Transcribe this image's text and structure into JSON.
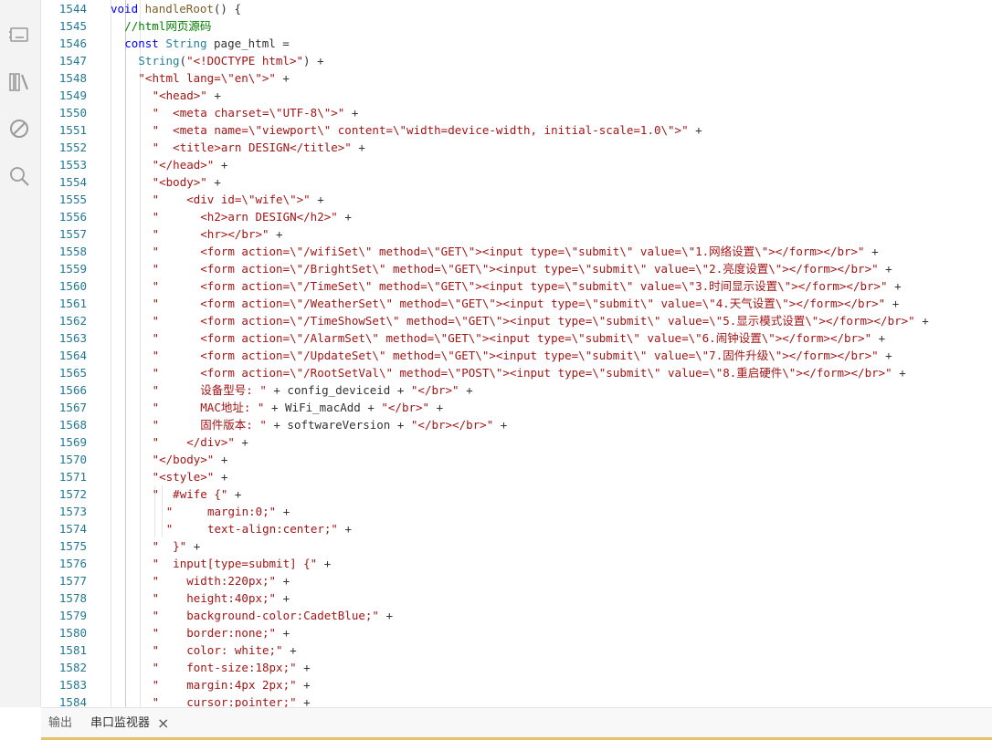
{
  "activity_bar": {
    "icons": [
      "board-icon",
      "library-icon",
      "debug-icon",
      "search-icon"
    ]
  },
  "editor": {
    "lines": [
      {
        "n": "1544",
        "indent": 0,
        "segs": [
          [
            "kw",
            "void "
          ],
          [
            "fn",
            "handleRoot"
          ],
          [
            "pl",
            "() {"
          ]
        ]
      },
      {
        "n": "1545",
        "indent": 2,
        "segs": [
          [
            "cm",
            "//html网页源码"
          ]
        ]
      },
      {
        "n": "1546",
        "indent": 2,
        "segs": [
          [
            "kw",
            "const "
          ],
          [
            "ty",
            "String "
          ],
          [
            "pl",
            "page_html ="
          ]
        ]
      },
      {
        "n": "1547",
        "indent": 4,
        "segs": [
          [
            "ty",
            "String"
          ],
          [
            "pl",
            "("
          ],
          [
            "str",
            "\"<!DOCTYPE html>\""
          ],
          [
            "pl",
            ") +"
          ]
        ]
      },
      {
        "n": "1548",
        "indent": 4,
        "segs": [
          [
            "str",
            "\"<html lang=\\\"en\\\">\""
          ],
          [
            "pl",
            " +"
          ]
        ]
      },
      {
        "n": "1549",
        "indent": 6,
        "segs": [
          [
            "str",
            "\"<head>\""
          ],
          [
            "pl",
            " +"
          ]
        ]
      },
      {
        "n": "1550",
        "indent": 6,
        "segs": [
          [
            "str",
            "\"  <meta charset=\\\"UTF-8\\\">\""
          ],
          [
            "pl",
            " +"
          ]
        ]
      },
      {
        "n": "1551",
        "indent": 6,
        "segs": [
          [
            "str",
            "\"  <meta name=\\\"viewport\\\" content=\\\"width=device-width, initial-scale=1.0\\\">\""
          ],
          [
            "pl",
            " +"
          ]
        ]
      },
      {
        "n": "1552",
        "indent": 6,
        "segs": [
          [
            "str",
            "\"  <title>arn DESIGN</title>\""
          ],
          [
            "pl",
            " +"
          ]
        ]
      },
      {
        "n": "1553",
        "indent": 6,
        "segs": [
          [
            "str",
            "\"</head>\""
          ],
          [
            "pl",
            " +"
          ]
        ]
      },
      {
        "n": "1554",
        "indent": 6,
        "segs": [
          [
            "str",
            "\"<body>\""
          ],
          [
            "pl",
            " +"
          ]
        ]
      },
      {
        "n": "1555",
        "indent": 6,
        "segs": [
          [
            "str",
            "\"    <div id=\\\"wife\\\">\""
          ],
          [
            "pl",
            " +"
          ]
        ]
      },
      {
        "n": "1556",
        "indent": 6,
        "segs": [
          [
            "str",
            "\"      <h2>arn DESIGN</h2>\""
          ],
          [
            "pl",
            " +"
          ]
        ]
      },
      {
        "n": "1557",
        "indent": 6,
        "segs": [
          [
            "str",
            "\"      <hr></br>\""
          ],
          [
            "pl",
            " +"
          ]
        ]
      },
      {
        "n": "1558",
        "indent": 6,
        "segs": [
          [
            "str",
            "\"      <form action=\\\"/wifiSet\\\" method=\\\"GET\\\"><input type=\\\"submit\\\" value=\\\"1.网络设置\\\"></form></br>\""
          ],
          [
            "pl",
            " +"
          ]
        ]
      },
      {
        "n": "1559",
        "indent": 6,
        "segs": [
          [
            "str",
            "\"      <form action=\\\"/BrightSet\\\" method=\\\"GET\\\"><input type=\\\"submit\\\" value=\\\"2.亮度设置\\\"></form></br>\""
          ],
          [
            "pl",
            " +"
          ]
        ]
      },
      {
        "n": "1560",
        "indent": 6,
        "segs": [
          [
            "str",
            "\"      <form action=\\\"/TimeSet\\\" method=\\\"GET\\\"><input type=\\\"submit\\\" value=\\\"3.时间显示设置\\\"></form></br>\""
          ],
          [
            "pl",
            " +"
          ]
        ]
      },
      {
        "n": "1561",
        "indent": 6,
        "segs": [
          [
            "str",
            "\"      <form action=\\\"/WeatherSet\\\" method=\\\"GET\\\"><input type=\\\"submit\\\" value=\\\"4.天气设置\\\"></form></br>\""
          ],
          [
            "pl",
            " +"
          ]
        ]
      },
      {
        "n": "1562",
        "indent": 6,
        "segs": [
          [
            "str",
            "\"      <form action=\\\"/TimeShowSet\\\" method=\\\"GET\\\"><input type=\\\"submit\\\" value=\\\"5.显示模式设置\\\"></form></br>\""
          ],
          [
            "pl",
            " +"
          ]
        ]
      },
      {
        "n": "1563",
        "indent": 6,
        "segs": [
          [
            "str",
            "\"      <form action=\\\"/AlarmSet\\\" method=\\\"GET\\\"><input type=\\\"submit\\\" value=\\\"6.闹钟设置\\\"></form></br>\""
          ],
          [
            "pl",
            " +"
          ]
        ]
      },
      {
        "n": "1564",
        "indent": 6,
        "segs": [
          [
            "str",
            "\"      <form action=\\\"/UpdateSet\\\" method=\\\"GET\\\"><input type=\\\"submit\\\" value=\\\"7.固件升级\\\"></form></br>\""
          ],
          [
            "pl",
            " +"
          ]
        ]
      },
      {
        "n": "1565",
        "indent": 6,
        "segs": [
          [
            "str",
            "\"      <form action=\\\"/RootSetVal\\\" method=\\\"POST\\\"><input type=\\\"submit\\\" value=\\\"8.重启硬件\\\"></form></br>\""
          ],
          [
            "pl",
            " +"
          ]
        ]
      },
      {
        "n": "1566",
        "indent": 6,
        "segs": [
          [
            "str",
            "\"      设备型号: \""
          ],
          [
            "pl",
            " + config_deviceid + "
          ],
          [
            "str",
            "\"</br>\""
          ],
          [
            "pl",
            " +"
          ]
        ]
      },
      {
        "n": "1567",
        "indent": 6,
        "segs": [
          [
            "str",
            "\"      MAC地址: \""
          ],
          [
            "pl",
            " + WiFi_macAdd + "
          ],
          [
            "str",
            "\"</br>\""
          ],
          [
            "pl",
            " +"
          ]
        ]
      },
      {
        "n": "1568",
        "indent": 6,
        "segs": [
          [
            "str",
            "\"      固件版本: \""
          ],
          [
            "pl",
            " + softwareVersion + "
          ],
          [
            "str",
            "\"</br></br>\""
          ],
          [
            "pl",
            " +"
          ]
        ]
      },
      {
        "n": "1569",
        "indent": 6,
        "segs": [
          [
            "str",
            "\"    </div>\""
          ],
          [
            "pl",
            " +"
          ]
        ]
      },
      {
        "n": "1570",
        "indent": 6,
        "segs": [
          [
            "str",
            "\"</body>\""
          ],
          [
            "pl",
            " +"
          ]
        ]
      },
      {
        "n": "1571",
        "indent": 6,
        "segs": [
          [
            "str",
            "\"<style>\""
          ],
          [
            "pl",
            " +"
          ]
        ]
      },
      {
        "n": "1572",
        "indent": 6,
        "segs": [
          [
            "str",
            "\"  #wife {\""
          ],
          [
            "pl",
            " +"
          ]
        ]
      },
      {
        "n": "1573",
        "indent": 8,
        "segs": [
          [
            "str",
            "\"     margin:0;\""
          ],
          [
            "pl",
            " +"
          ]
        ]
      },
      {
        "n": "1574",
        "indent": 8,
        "segs": [
          [
            "str",
            "\"     text-align:center;\""
          ],
          [
            "pl",
            " +"
          ]
        ]
      },
      {
        "n": "1575",
        "indent": 6,
        "segs": [
          [
            "str",
            "\"  }\""
          ],
          [
            "pl",
            " +"
          ]
        ]
      },
      {
        "n": "1576",
        "indent": 6,
        "segs": [
          [
            "str",
            "\"  input[type=submit] {\""
          ],
          [
            "pl",
            " +"
          ]
        ]
      },
      {
        "n": "1577",
        "indent": 6,
        "segs": [
          [
            "str",
            "\"    width:220px;\""
          ],
          [
            "pl",
            " +"
          ]
        ]
      },
      {
        "n": "1578",
        "indent": 6,
        "segs": [
          [
            "str",
            "\"    height:40px;\""
          ],
          [
            "pl",
            " +"
          ]
        ]
      },
      {
        "n": "1579",
        "indent": 6,
        "segs": [
          [
            "str",
            "\"    background-color:CadetBlue;\""
          ],
          [
            "pl",
            " +"
          ]
        ]
      },
      {
        "n": "1580",
        "indent": 6,
        "segs": [
          [
            "str",
            "\"    border:none;\""
          ],
          [
            "pl",
            " +"
          ]
        ]
      },
      {
        "n": "1581",
        "indent": 6,
        "segs": [
          [
            "str",
            "\"    color: white;\""
          ],
          [
            "pl",
            " +"
          ]
        ]
      },
      {
        "n": "1582",
        "indent": 6,
        "segs": [
          [
            "str",
            "\"    font-size:18px;\""
          ],
          [
            "pl",
            " +"
          ]
        ]
      },
      {
        "n": "1583",
        "indent": 6,
        "segs": [
          [
            "str",
            "\"    margin:4px 2px;\""
          ],
          [
            "pl",
            " +"
          ]
        ]
      },
      {
        "n": "1584",
        "indent": 6,
        "segs": [
          [
            "str",
            "\"    cursor:pointer;\""
          ],
          [
            "pl",
            " +"
          ]
        ]
      }
    ]
  },
  "panel": {
    "tabs": [
      {
        "label": "输出"
      },
      {
        "label": "串口监视器"
      }
    ],
    "close_glyph": "×"
  }
}
